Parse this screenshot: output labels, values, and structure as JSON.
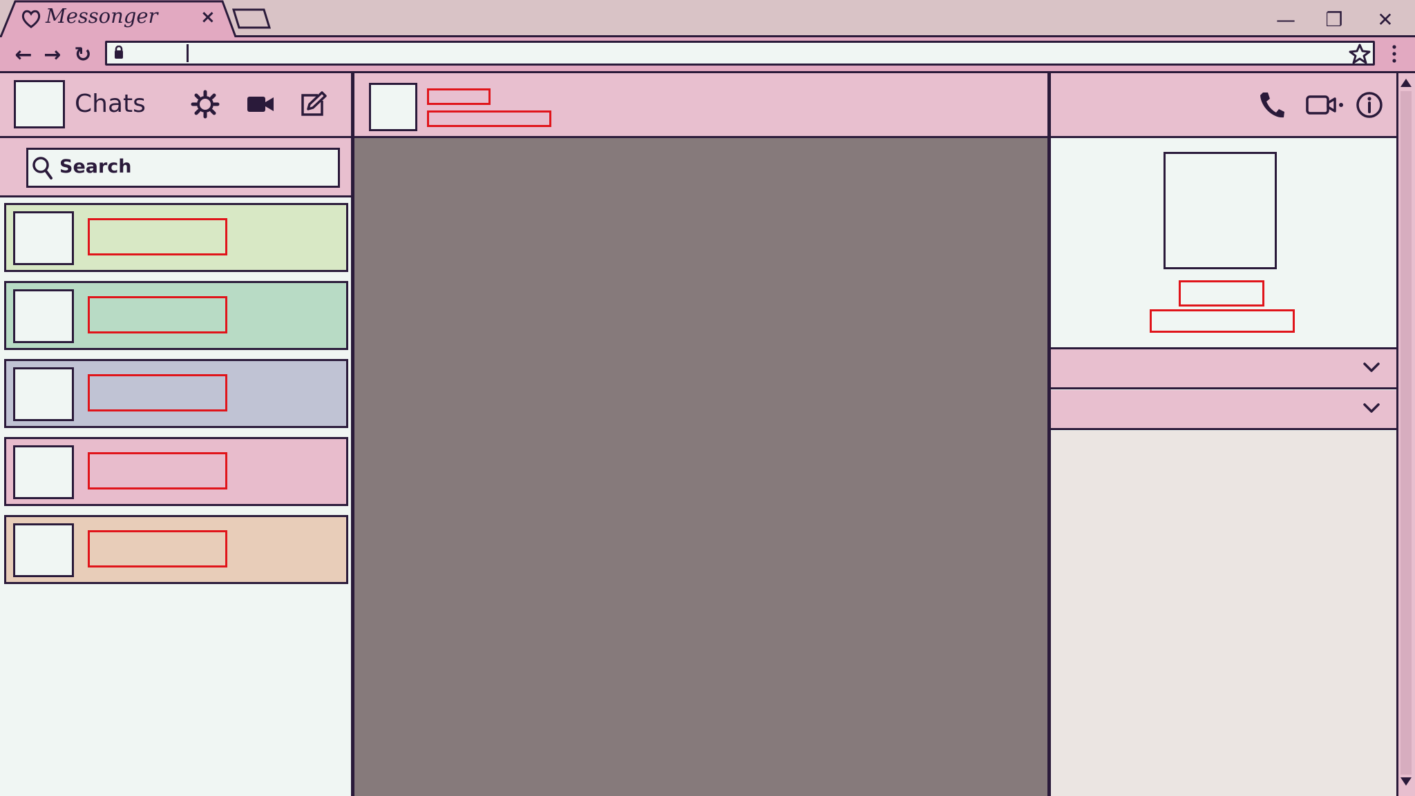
{
  "browser": {
    "tab_title": "Messonger",
    "tab_close": "×",
    "window_controls": {
      "minimize": "—",
      "maximize": "❐",
      "close": "✕"
    },
    "nav": {
      "back": "←",
      "forward": "→",
      "reload": "↻"
    },
    "address_value": ""
  },
  "left": {
    "title": "Chats",
    "search_placeholder": "Search",
    "chats": [
      {
        "color": "#d8e8c5"
      },
      {
        "color": "#b8dbc5"
      },
      {
        "color": "#c0c3d4"
      },
      {
        "color": "#e8bccc"
      },
      {
        "color": "#e8cdb9"
      }
    ]
  },
  "colors": {
    "ink": "#2a1a3a",
    "header_pink": "#e8bfcf",
    "tab_pink": "#e2a9c1",
    "message_area": "#867a7b",
    "placeholder_outline": "#e0141a"
  },
  "icons": {
    "tab": "heart-icon",
    "header": [
      "gear-icon",
      "video-camera-icon",
      "compose-icon"
    ],
    "conversation": [
      "phone-icon",
      "video-call-icon",
      "info-icon"
    ]
  }
}
